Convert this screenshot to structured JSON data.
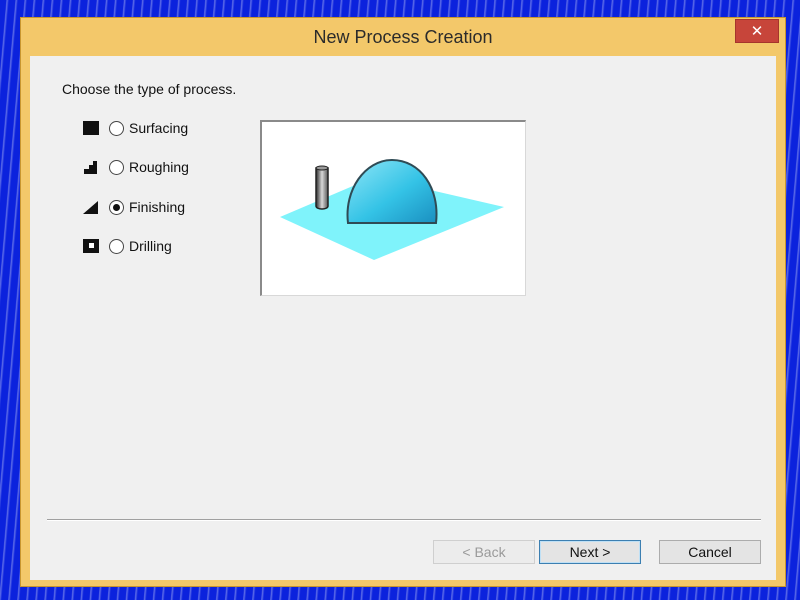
{
  "window": {
    "title": "New Process Creation",
    "close_glyph": "✕"
  },
  "content": {
    "prompt": "Choose the type of process."
  },
  "options": [
    {
      "label": "Surfacing",
      "icon": "surfacing-icon",
      "checked": false
    },
    {
      "label": "Roughing",
      "icon": "roughing-icon",
      "checked": false
    },
    {
      "label": "Finishing",
      "icon": "finishing-icon",
      "checked": true
    },
    {
      "label": "Drilling",
      "icon": "drilling-icon",
      "checked": false
    }
  ],
  "preview": {
    "image": "finishing-dome-preview"
  },
  "buttons": {
    "back": "< Back",
    "next": "Next >",
    "cancel": "Cancel",
    "back_enabled": false
  },
  "colors": {
    "titlebar": "#f3c86a",
    "close": "#c7453a",
    "desktop": "#0b22dd",
    "plane": "#7ff3fb",
    "dome": "#34c3e6"
  }
}
